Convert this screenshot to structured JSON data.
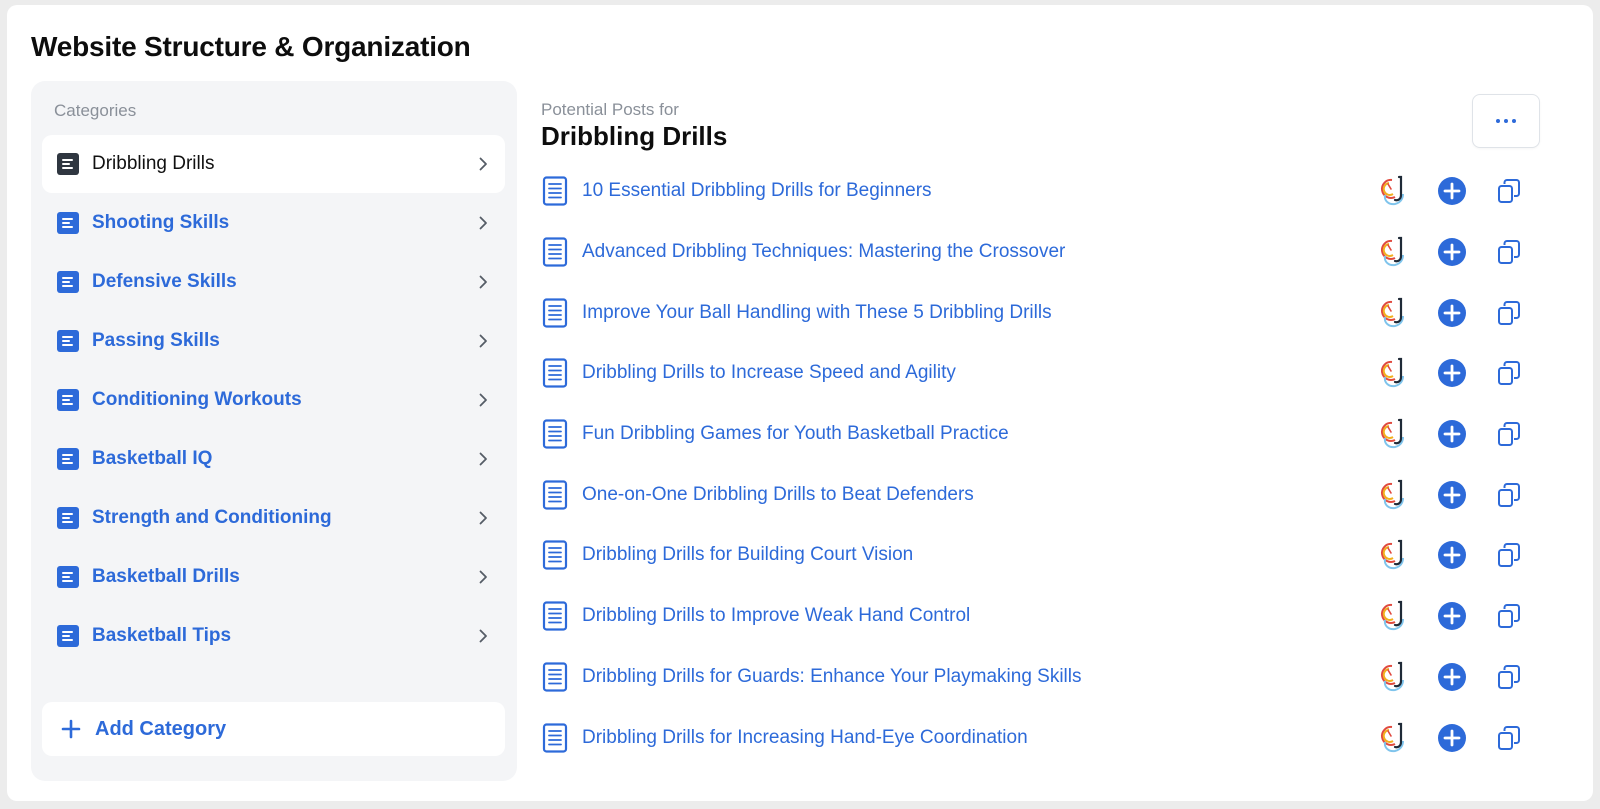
{
  "page": {
    "title": "Website Structure & Organization"
  },
  "sidebar": {
    "heading": "Categories",
    "items": [
      {
        "label": "Dribbling Drills",
        "active": true
      },
      {
        "label": "Shooting Skills",
        "active": false
      },
      {
        "label": "Defensive Skills",
        "active": false
      },
      {
        "label": "Passing Skills",
        "active": false
      },
      {
        "label": "Conditioning Workouts",
        "active": false
      },
      {
        "label": "Basketball IQ",
        "active": false
      },
      {
        "label": "Strength and Conditioning",
        "active": false
      },
      {
        "label": "Basketball Drills",
        "active": false
      },
      {
        "label": "Basketball Tips",
        "active": false
      }
    ],
    "add_label": "Add Category"
  },
  "main": {
    "subtitle": "Potential Posts for",
    "title": "Dribbling Drills",
    "posts": [
      "10 Essential Dribbling Drills for Beginners",
      "Advanced Dribbling Techniques: Mastering the Crossover",
      "Improve Your Ball Handling with These 5 Dribbling Drills",
      "Dribbling Drills to Increase Speed and Agility",
      "Fun Dribbling Games for Youth Basketball Practice",
      "One-on-One Dribbling Drills to Beat Defenders",
      "Dribbling Drills for Building Court Vision",
      "Dribbling Drills to Improve Weak Hand Control",
      "Dribbling Drills for Guards: Enhance Your Playmaking Skills",
      "Dribbling Drills for Increasing Hand-Eye Coordination"
    ]
  },
  "icons": {
    "category": "document-lines-icon",
    "chevron": "chevron-right-icon",
    "post": "document-icon",
    "ai": "ai-writer-icon",
    "add": "plus-circle-icon",
    "copy": "copy-icon",
    "more": "more-horizontal-icon"
  },
  "colors": {
    "accent": "#2d6ad9",
    "active_icon": "#2f3640",
    "sidebar_bg": "#f4f5f7",
    "muted_text": "#8a9099"
  }
}
